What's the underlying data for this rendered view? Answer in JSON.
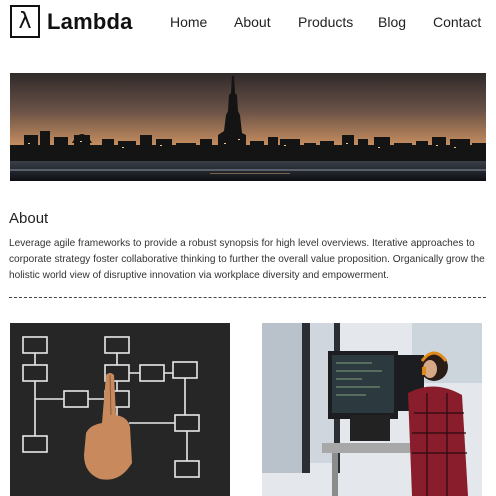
{
  "brand": {
    "symbol": "λ",
    "name": "Lambda"
  },
  "nav": {
    "items": [
      {
        "label": "Home"
      },
      {
        "label": "About"
      },
      {
        "label": "Products"
      },
      {
        "label": "Blog"
      },
      {
        "label": "Contact"
      }
    ]
  },
  "hero": {
    "image": "city-skyline-at-dusk"
  },
  "about": {
    "title": "About",
    "body": "Leverage agile frameworks to provide a robust synopsis for high level overviews. Iterative approaches to corporate strategy foster collaborative thinking to further the overall value proposition. Organically grow the holistic world view of disruptive innovation via workplace diversity and empowerment."
  },
  "gallery": {
    "left_image": "hand-drawing-flowchart-on-chalkboard",
    "right_image": "woman-with-headphones-at-computer-desk"
  }
}
